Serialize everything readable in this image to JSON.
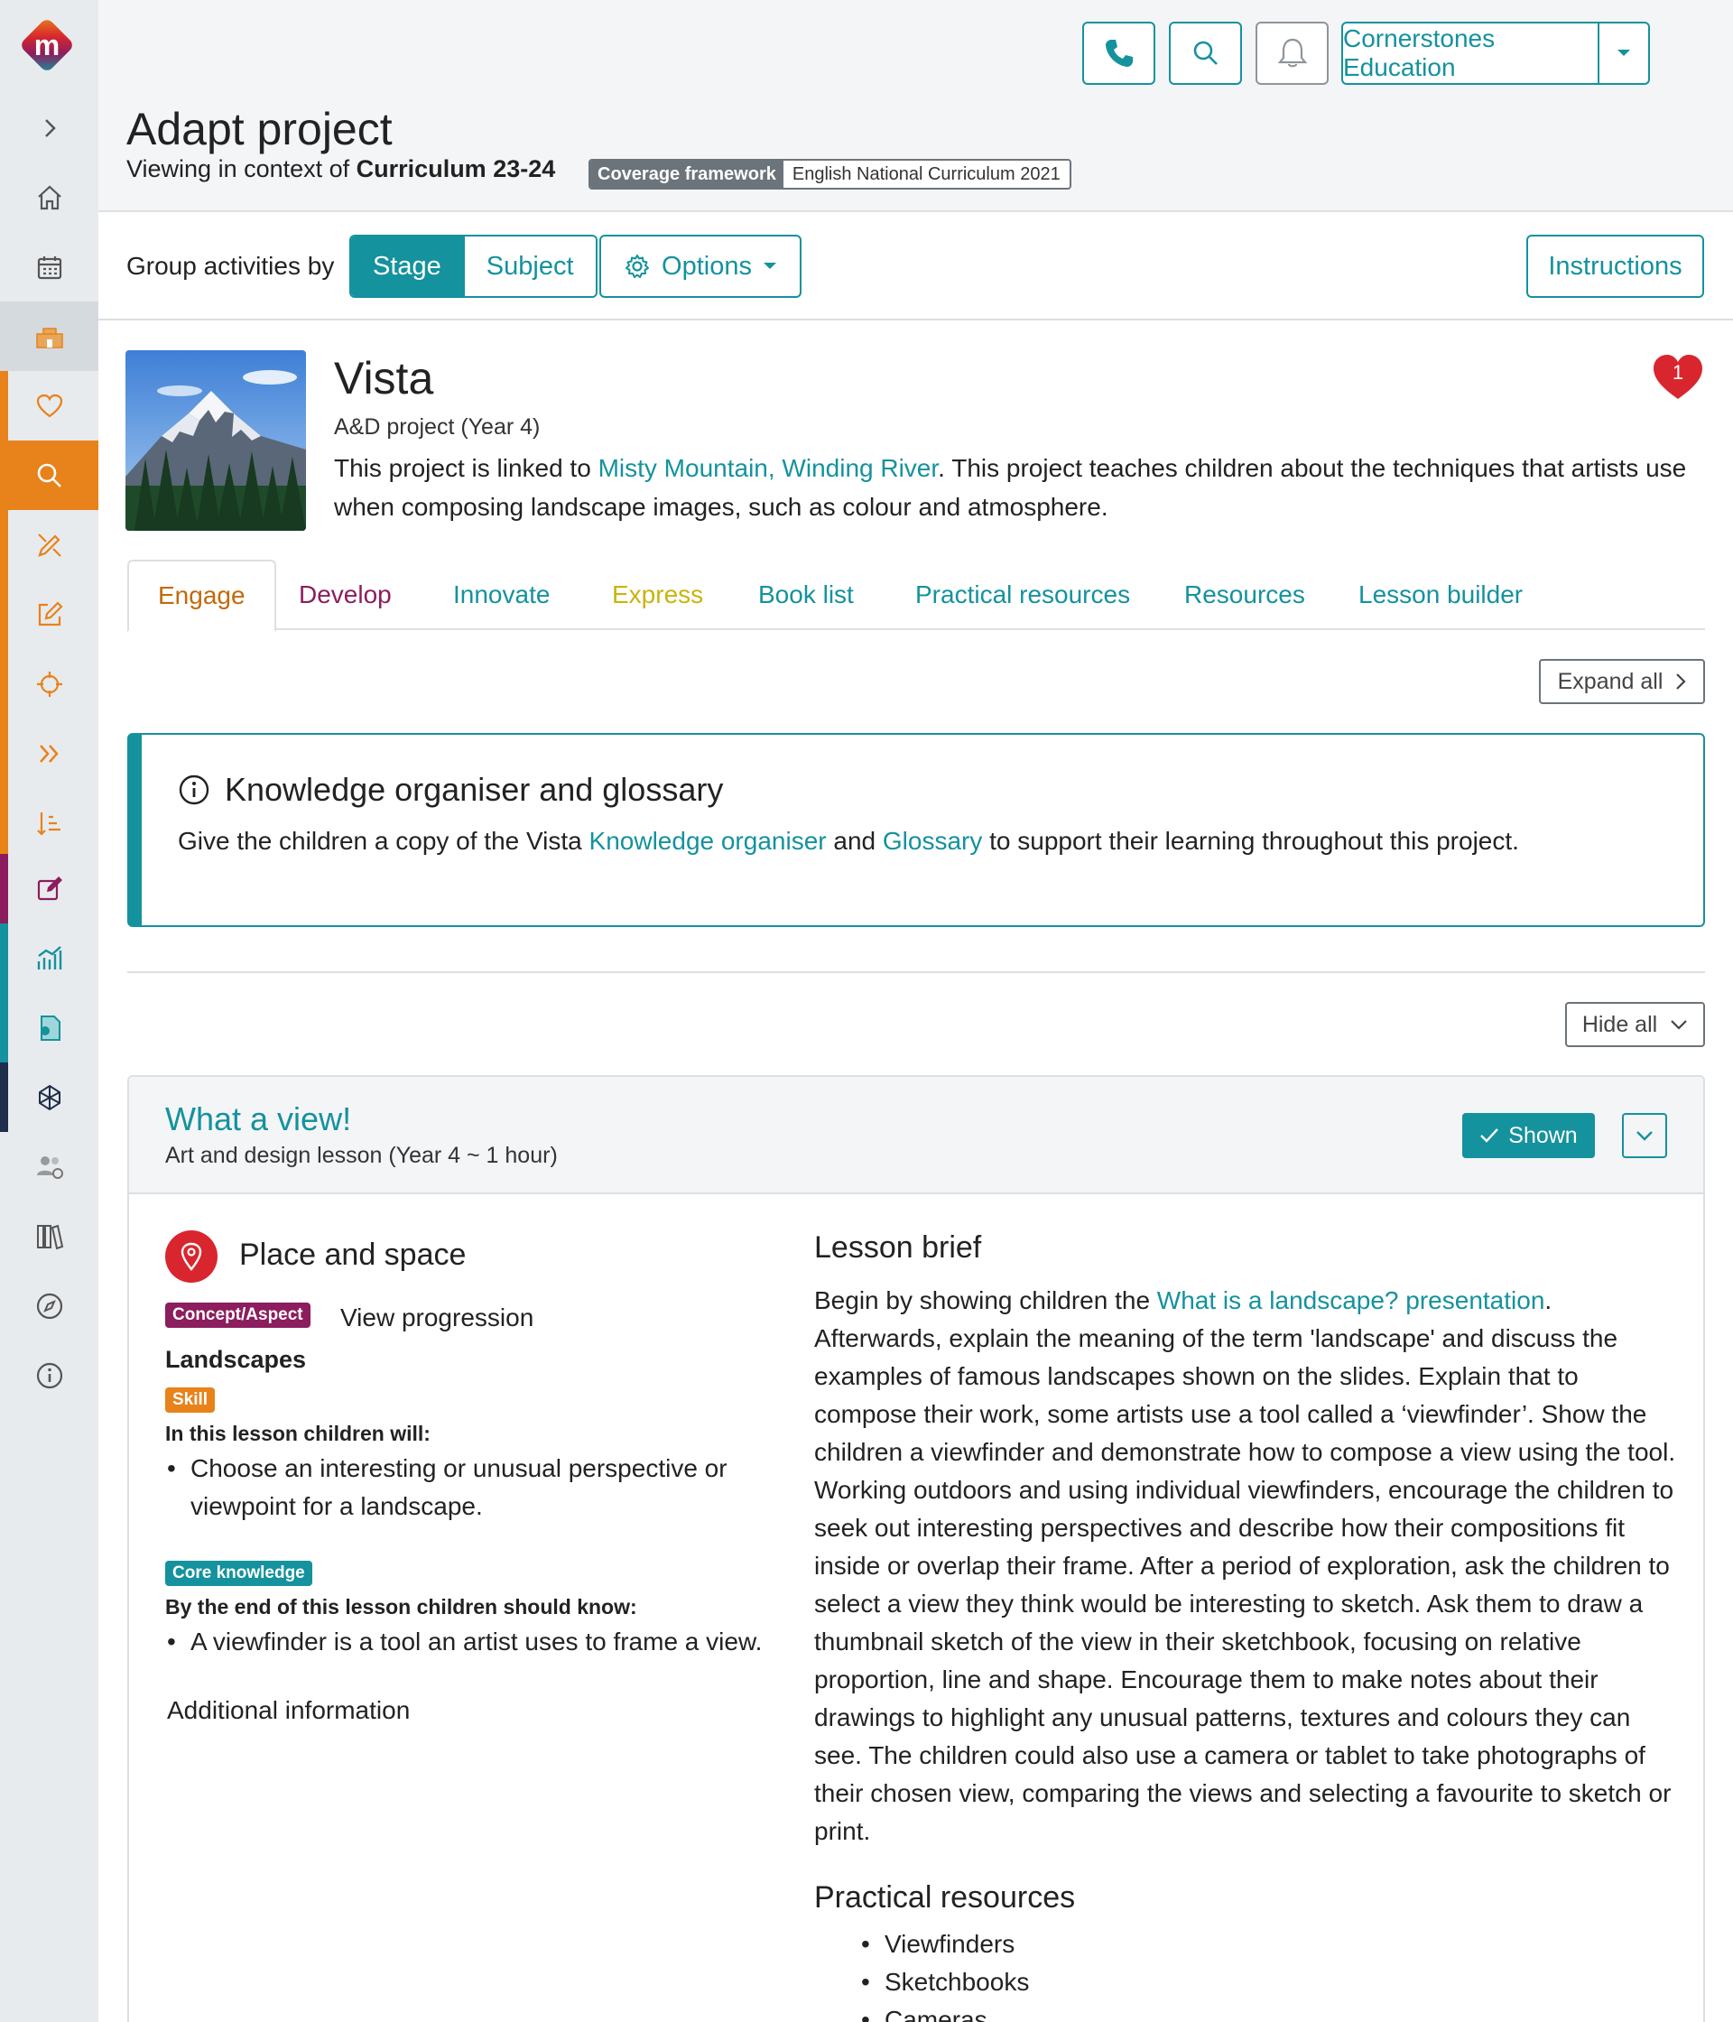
{
  "header": {
    "title": "Adapt project",
    "context_prefix": "Viewing in context of",
    "context_value": "Curriculum 23-24",
    "framework_label": "Coverage framework",
    "framework_value": "English National Curriculum 2021",
    "org_name": "Cornerstones Education"
  },
  "toolbar": {
    "group_label": "Group activities by",
    "stage_label": "Stage",
    "subject_label": "Subject",
    "options_label": "Options",
    "instructions_label": "Instructions"
  },
  "project": {
    "title": "Vista",
    "type": "A&D project (Year 4)",
    "desc_prefix": "This project is linked to",
    "linked_project": "Misty Mountain, Winding River",
    "desc_suffix": ". This project teaches children about the techniques that artists use when composing landscape images, such as colour and atmosphere.",
    "favourite_count": "1"
  },
  "tabs": {
    "engage": "Engage",
    "develop": "Develop",
    "innovate": "Innovate",
    "express": "Express",
    "book_list": "Book list",
    "practical": "Practical resources",
    "resources": "Resources",
    "lesson_builder": "Lesson builder"
  },
  "controls": {
    "expand_all": "Expand all",
    "hide_all": "Hide all"
  },
  "info": {
    "title": "Knowledge organiser and glossary",
    "text_prefix": "Give the children a copy of the Vista",
    "link1": "Knowledge organiser",
    "text_mid": "and",
    "link2": "Glossary",
    "text_suffix": "to support their learning throughout this project."
  },
  "lesson": {
    "title": "What a view!",
    "subtitle": "Art and design lesson (Year 4 ~ 1 hour)",
    "shown_label": "Shown",
    "place_title": "Place and space",
    "concept_badge": "Concept/Aspect",
    "view_progression": "View progression",
    "concept_name": "Landscapes",
    "skill_badge": "Skill",
    "will_heading": "In this lesson children will:",
    "will_items": [
      "Choose an interesting or unusual perspective or",
      "viewpoint for a landscape."
    ],
    "core_badge": "Core knowledge",
    "know_heading": "By the end of this lesson children should know:",
    "know_item": "A viewfinder is a tool an artist uses to frame a view.",
    "additional": "Additional information",
    "brief_title": "Lesson brief",
    "brief_prefix": "Begin by showing children the",
    "brief_link": "What is a landscape? presentation",
    "brief_text": ". Afterwards, explain the meaning of the term 'landscape' and discuss the examples of famous landscapes shown on the slides. Explain that to compose their work, some artists use a tool called a ‘viewfinder’. Show the children a viewfinder and demonstrate how to compose a view using the tool. Working outdoors and using individual viewfinders, encourage the children to seek out interesting perspectives and describe how their compositions fit inside or overlap their frame. After a period of exploration, ask the children to select a view they think would be interesting to sketch. Ask them to draw a thumbnail sketch of the view in their sketchbook, focusing on relative proportion, line and shape. Encourage them to make notes about their drawings to highlight any unusual patterns, textures and colours they can see. The children could also use a camera or tablet to take photographs of their chosen view, comparing the views and selecting a favourite to sketch or print.",
    "practical_title": "Practical resources",
    "practical_items": [
      "Viewfinders",
      "Sketchbooks",
      "Cameras"
    ]
  },
  "colors": {
    "teal": "#14929d",
    "orange": "#e8821a",
    "engage": "#c26a0a",
    "develop": "#8c1d5e",
    "express": "#c9b40e",
    "favourite": "#d9262e"
  }
}
